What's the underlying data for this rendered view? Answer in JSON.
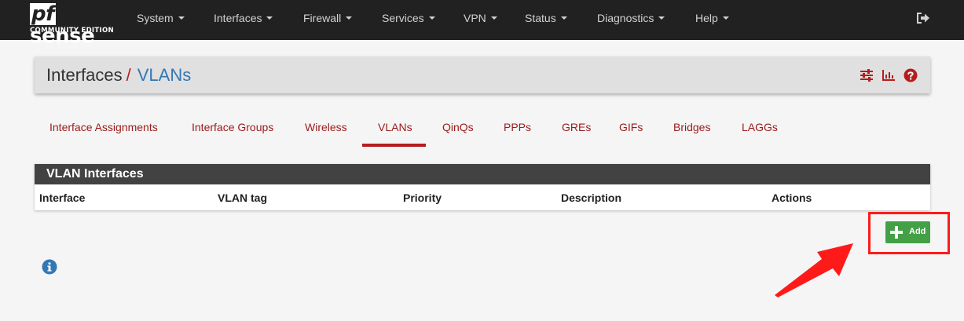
{
  "brand": {
    "logo_prefix": "pf",
    "logo_main": "sense",
    "logo_sub": "COMMUNITY EDITION"
  },
  "nav": {
    "items": [
      {
        "label": "System"
      },
      {
        "label": "Interfaces"
      },
      {
        "label": "Firewall"
      },
      {
        "label": "Services"
      },
      {
        "label": "VPN"
      },
      {
        "label": "Status"
      },
      {
        "label": "Diagnostics"
      },
      {
        "label": "Help"
      }
    ],
    "logout_icon": "sign-out-icon"
  },
  "header": {
    "breadcrumb_parent": "Interfaces",
    "breadcrumb_separator": "/",
    "breadcrumb_current": "VLANs",
    "icons": [
      "sliders-icon",
      "bar-chart-icon",
      "question-circle-icon"
    ]
  },
  "tabs": [
    {
      "label": "Interface Assignments"
    },
    {
      "label": "Interface Groups"
    },
    {
      "label": "Wireless"
    },
    {
      "label": "VLANs",
      "active": true
    },
    {
      "label": "QinQs"
    },
    {
      "label": "PPPs"
    },
    {
      "label": "GREs"
    },
    {
      "label": "GIFs"
    },
    {
      "label": "Bridges"
    },
    {
      "label": "LAGGs"
    }
  ],
  "vlan_table": {
    "title": "VLAN Interfaces",
    "columns": [
      "Interface",
      "VLAN tag",
      "Priority",
      "Description",
      "Actions"
    ],
    "rows": []
  },
  "actions": {
    "add_label": "Add"
  },
  "colors": {
    "navbar_bg": "#212121",
    "accent_red": "#b71c1c",
    "link_blue": "#3278b4",
    "success_green": "#43a047",
    "annotation_red": "#ff1a1a"
  }
}
